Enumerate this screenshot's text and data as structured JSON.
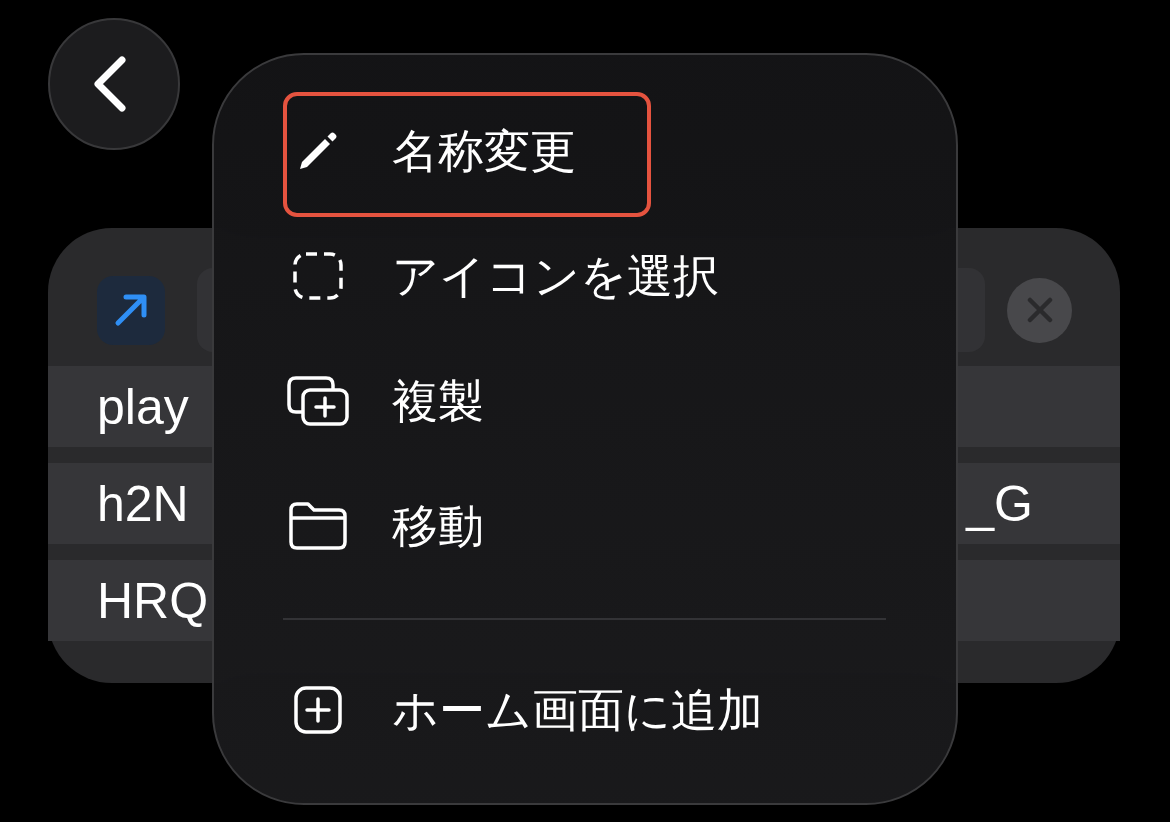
{
  "card": {
    "rows": [
      {
        "text": "play"
      },
      {
        "text": "h2N",
        "trailing": "_G"
      },
      {
        "text": "HRQ"
      }
    ]
  },
  "menu": {
    "groups": [
      {
        "items": [
          {
            "label": "名称変更",
            "highlighted": true
          },
          {
            "label": "アイコンを選択",
            "highlighted": false
          },
          {
            "label": "複製",
            "highlighted": false
          },
          {
            "label": "移動",
            "highlighted": false
          }
        ]
      },
      {
        "items": [
          {
            "label": "ホーム画面に追加",
            "highlighted": false
          }
        ]
      }
    ]
  }
}
